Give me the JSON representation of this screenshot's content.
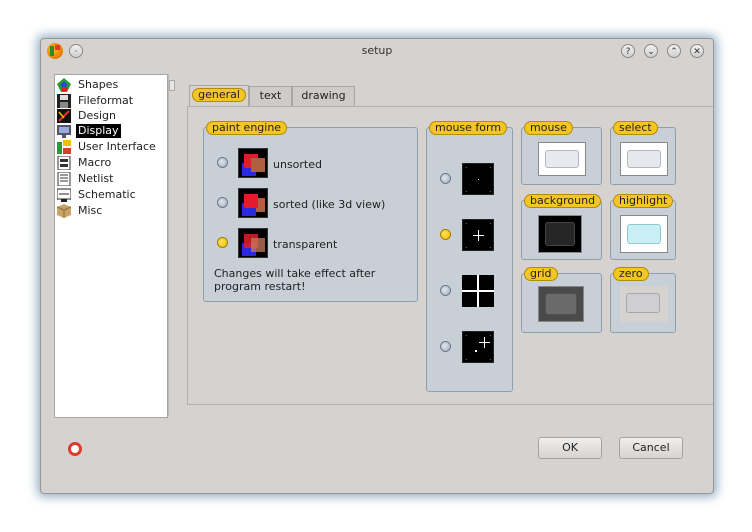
{
  "window": {
    "title": "setup",
    "buttons": {
      "help": "?",
      "minimize": "⌄",
      "maximize": "⌃",
      "close": "✕",
      "menu": "·"
    }
  },
  "sidebar": {
    "items": [
      {
        "label": "Shapes",
        "icon": "shapes-icon",
        "selected": false
      },
      {
        "label": "Fileformat",
        "icon": "floppy-disk-icon",
        "selected": false
      },
      {
        "label": "Design",
        "icon": "design-icon",
        "selected": false
      },
      {
        "label": "Display",
        "icon": "monitor-icon",
        "selected": true
      },
      {
        "label": "User Interface",
        "icon": "user-interface-icon",
        "selected": false
      },
      {
        "label": "Macro",
        "icon": "macro-icon",
        "selected": false
      },
      {
        "label": "Netlist",
        "icon": "netlist-icon",
        "selected": false
      },
      {
        "label": "Schematic",
        "icon": "schematic-icon",
        "selected": false
      },
      {
        "label": "Misc",
        "icon": "package-icon",
        "selected": false
      }
    ]
  },
  "tabs": [
    {
      "label": "general",
      "active": true
    },
    {
      "label": "text",
      "active": false
    },
    {
      "label": "drawing",
      "active": false
    }
  ],
  "paint_engine": {
    "label": "paint engine",
    "options": [
      {
        "label": "unsorted",
        "selected": false
      },
      {
        "label": "sorted (like 3d view)",
        "selected": false
      },
      {
        "label": "transparent",
        "selected": true
      }
    ],
    "note": "Changes will take effect after program restart!"
  },
  "mouse_form": {
    "label": "mouse form",
    "options": [
      {
        "name": "dot-cursor",
        "selected": false
      },
      {
        "name": "small-cross-cursor",
        "selected": true
      },
      {
        "name": "big-cross-cursor",
        "selected": false
      },
      {
        "name": "cross-arrow-cursor",
        "selected": false
      }
    ]
  },
  "colors": {
    "mouse": {
      "label": "mouse",
      "color": "#e8e9ee"
    },
    "select": {
      "label": "select",
      "color": "#e6e8ef"
    },
    "background": {
      "label": "background",
      "color": "#262626"
    },
    "highlight": {
      "label": "highlight",
      "color": "#c8f0f4"
    },
    "grid": {
      "label": "grid",
      "color": "#6a6a6a"
    },
    "zero": {
      "label": "zero",
      "color": "#cfcfd3"
    }
  },
  "buttons": {
    "ok": "OK",
    "cancel": "Cancel"
  }
}
